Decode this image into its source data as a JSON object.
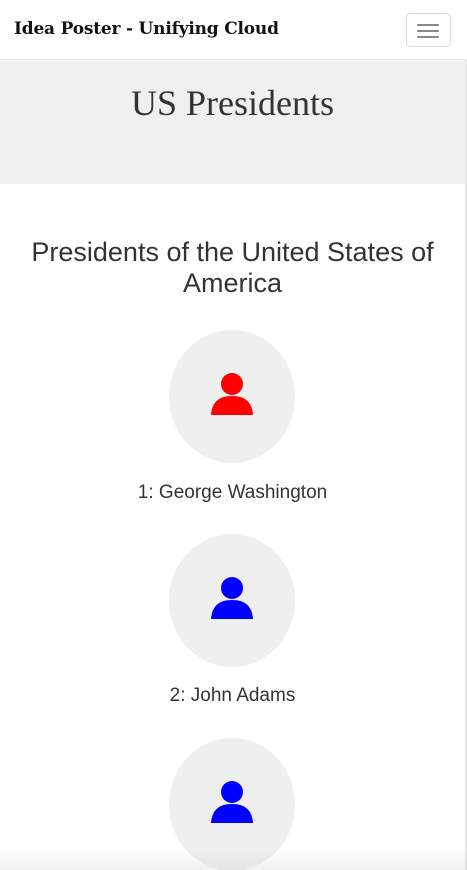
{
  "navbar": {
    "brand": "Idea Poster - Unifying Cloud",
    "toggle_icon": "hamburger-menu-icon"
  },
  "jumbotron": {
    "title": "US Presidents"
  },
  "section": {
    "title": "Presidents of the United States of America"
  },
  "presidents": [
    {
      "label": "1: George Washington",
      "icon": "person-icon",
      "color": "#ff0000"
    },
    {
      "label": "2: John Adams",
      "icon": "person-icon",
      "color": "#0000ff"
    },
    {
      "label": "",
      "icon": "person-icon",
      "color": "#0000ff"
    }
  ],
  "colors": {
    "jumbotron_bg": "#f0f0f0",
    "avatar_bg": "#efefef"
  }
}
